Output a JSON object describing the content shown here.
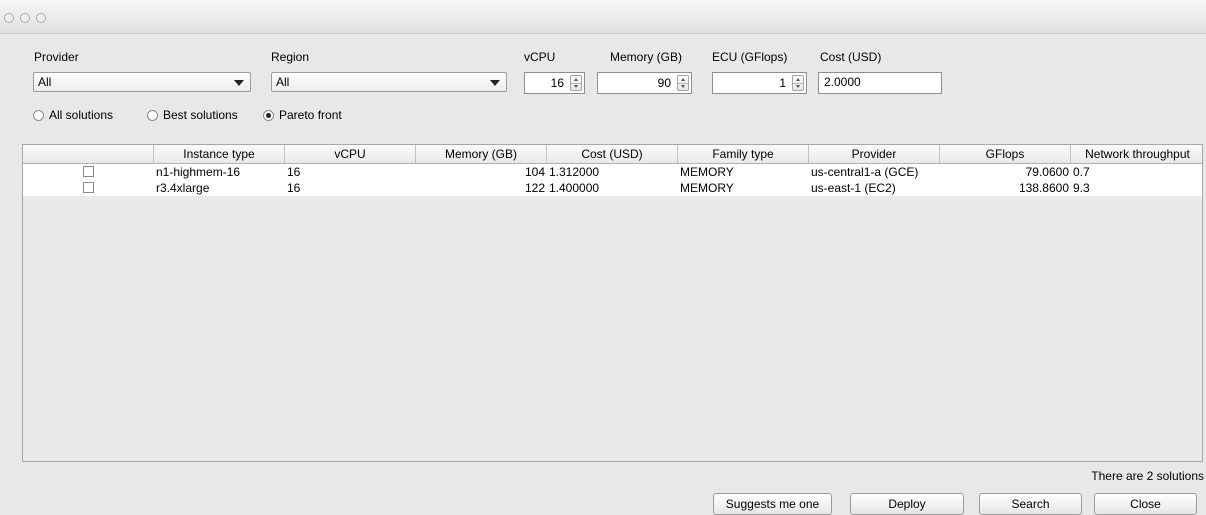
{
  "filters": {
    "provider_label": "Provider",
    "provider_value": "All",
    "region_label": "Region",
    "region_value": "All",
    "vcpu_label": "vCPU",
    "vcpu_value": "16",
    "memory_label": "Memory (GB)",
    "memory_value": "90",
    "ecu_label": "ECU (GFlops)",
    "ecu_value": "1",
    "cost_label": "Cost (USD)",
    "cost_value": "2.0000"
  },
  "modes": [
    {
      "label": "All solutions",
      "selected": false
    },
    {
      "label": "Best solutions",
      "selected": false
    },
    {
      "label": "Pareto front",
      "selected": true
    }
  ],
  "table": {
    "columns": [
      "",
      "Instance type",
      "vCPU",
      "Memory (GB)",
      "Cost (USD)",
      "Family type",
      "Provider",
      "GFlops",
      "Network throughput"
    ],
    "rows": [
      {
        "checked": false,
        "instance": "n1-highmem-16",
        "vcpu": "16",
        "memory": "104",
        "cost": "1.312000",
        "family": "MEMORY",
        "provider": "us-central1-a (GCE)",
        "gflops": "79.0600",
        "network": "0.7"
      },
      {
        "checked": false,
        "instance": "r3.4xlarge",
        "vcpu": "16",
        "memory": "122",
        "cost": "1.400000",
        "family": "MEMORY",
        "provider": "us-east-1 (EC2)",
        "gflops": "138.8600",
        "network": "9.3"
      }
    ]
  },
  "status_text": "There are 2 solutions",
  "buttons": {
    "suggest": "Suggests me one",
    "deploy": "Deploy",
    "search": "Search",
    "close": "Close"
  }
}
